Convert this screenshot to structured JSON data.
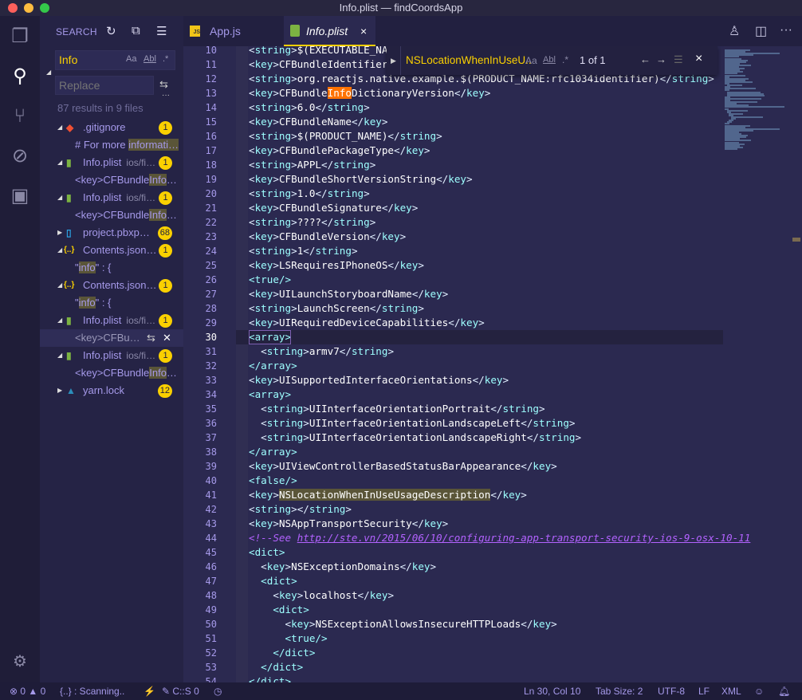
{
  "window": {
    "title": "Info.plist — findCoordsApp"
  },
  "activity": {
    "icons": [
      "files-icon",
      "search-icon",
      "source-control-icon",
      "debug-icon",
      "extensions-icon",
      "gear-icon"
    ]
  },
  "search": {
    "header": "SEARCH",
    "query": "Info",
    "replace_placeholder": "Replace",
    "opt_case": "Aa",
    "opt_word": "Abl",
    "opt_regex": ".*",
    "more": "···",
    "summary": "87 results in 9 files",
    "results": [
      {
        "type": "file",
        "icon": "git",
        "expanded": true,
        "name": ".gitignore",
        "path": "",
        "count": "1"
      },
      {
        "type": "match",
        "pre": "# For more ",
        "hit": "informati…",
        "post": ""
      },
      {
        "type": "file",
        "icon": "plist",
        "expanded": true,
        "name": "Info.plist",
        "path": "ios/fi…",
        "count": "1"
      },
      {
        "type": "match",
        "pre": "<key>CFBundle",
        "hit": "Info",
        "post": "…"
      },
      {
        "type": "file",
        "icon": "plist",
        "expanded": true,
        "name": "Info.plist",
        "path": "ios/fi…",
        "count": "1"
      },
      {
        "type": "match",
        "pre": "<key>CFBundle",
        "hit": "Info",
        "post": "…"
      },
      {
        "type": "file",
        "icon": "doc",
        "expanded": false,
        "name": "project.pbxp…",
        "path": "",
        "count": "68"
      },
      {
        "type": "file",
        "icon": "json",
        "expanded": true,
        "name": "Contents.json…",
        "path": "",
        "count": "1"
      },
      {
        "type": "match",
        "pre": "\"",
        "hit": "info",
        "post": "\" : {"
      },
      {
        "type": "file",
        "icon": "json",
        "expanded": true,
        "name": "Contents.json…",
        "path": "",
        "count": "1"
      },
      {
        "type": "match",
        "pre": "\"",
        "hit": "info",
        "post": "\" : {"
      },
      {
        "type": "file",
        "icon": "plist",
        "expanded": true,
        "name": "Info.plist",
        "path": "ios/fi…",
        "count": "1"
      },
      {
        "type": "match",
        "selected": true,
        "pre": "<key>CFBu…",
        "hit": "",
        "post": ""
      },
      {
        "type": "file",
        "icon": "plist",
        "expanded": true,
        "name": "Info.plist",
        "path": "ios/fi…",
        "count": "1"
      },
      {
        "type": "match",
        "pre": "<key>CFBundle",
        "hit": "Info",
        "post": "…"
      },
      {
        "type": "file",
        "icon": "yarn",
        "expanded": false,
        "name": "yarn.lock",
        "path": "",
        "count": "12"
      }
    ]
  },
  "tabs": [
    {
      "label": "App.js",
      "icon": "JS",
      "active": false
    },
    {
      "label": "Info.plist",
      "icon": "plist",
      "active": true,
      "close": "×"
    }
  ],
  "find_widget": {
    "query": "NSLocationWhenInUseU..",
    "opt_case": "Aa",
    "opt_word": "Abl",
    "opt_regex": ".*",
    "count": "1 of 1",
    "prev": "←",
    "next": "→",
    "close": "×"
  },
  "editor": {
    "first_line": 10,
    "current_line": 30,
    "lines": [
      "<string>$(EXECUTABLE_NAME)</string>",
      "<key>CFBundleIdentifier</key>",
      "<string>org.reactjs.native.example.$(PRODUCT_NAME:rfc1034identifier)</string>",
      "<key>CFBundleInfoDictionaryVersion</key>",
      "<string>6.0</string>",
      "<key>CFBundleName</key>",
      "<string>$(PRODUCT_NAME)</string>",
      "<key>CFBundlePackageType</key>",
      "<string>APPL</string>",
      "<key>CFBundleShortVersionString</key>",
      "<string>1.0</string>",
      "<key>CFBundleSignature</key>",
      "<string>????</string>",
      "<key>CFBundleVersion</key>",
      "<string>1</string>",
      "<key>LSRequiresIPhoneOS</key>",
      "<true/>",
      "<key>UILaunchStoryboardName</key>",
      "<string>LaunchScreen</string>",
      "<key>UIRequiredDeviceCapabilities</key>",
      "<array>",
      "  <string>armv7</string>",
      "</array>",
      "<key>UISupportedInterfaceOrientations</key>",
      "<array>",
      "  <string>UIInterfaceOrientationPortrait</string>",
      "  <string>UIInterfaceOrientationLandscapeLeft</string>",
      "  <string>UIInterfaceOrientationLandscapeRight</string>",
      "</array>",
      "<key>UIViewControllerBasedStatusBarAppearance</key>",
      "<false/>",
      "<key>NSLocationWhenInUseUsageDescription</key>",
      "<string></string>",
      "<key>NSAppTransportSecurity</key>",
      "<!--See http://ste.vn/2015/06/10/configuring-app-transport-security-ios-9-osx-10-11",
      "<dict>",
      "  <key>NSExceptionDomains</key>",
      "  <dict>",
      "    <key>localhost</key>",
      "    <dict>",
      "      <key>NSExceptionAllowsInsecureHTTPLoads</key>",
      "      <true/>",
      "    </dict>",
      "  </dict>",
      "</dict>"
    ]
  },
  "status": {
    "errors": "0",
    "warnings": "0",
    "scanning": "{..} : Scanning..",
    "lightning": "⚡",
    "cs": "C::S 0",
    "position": "Ln 30, Col 10",
    "tab_size": "Tab Size: 2",
    "encoding": "UTF-8",
    "eol": "LF",
    "language": "XML"
  },
  "colors": {
    "accent": "#fad000",
    "background": "#2b2950",
    "sidebar": "#252345",
    "tag": "#9effff",
    "comment": "#b362ff",
    "find_match": "#ff7200"
  }
}
